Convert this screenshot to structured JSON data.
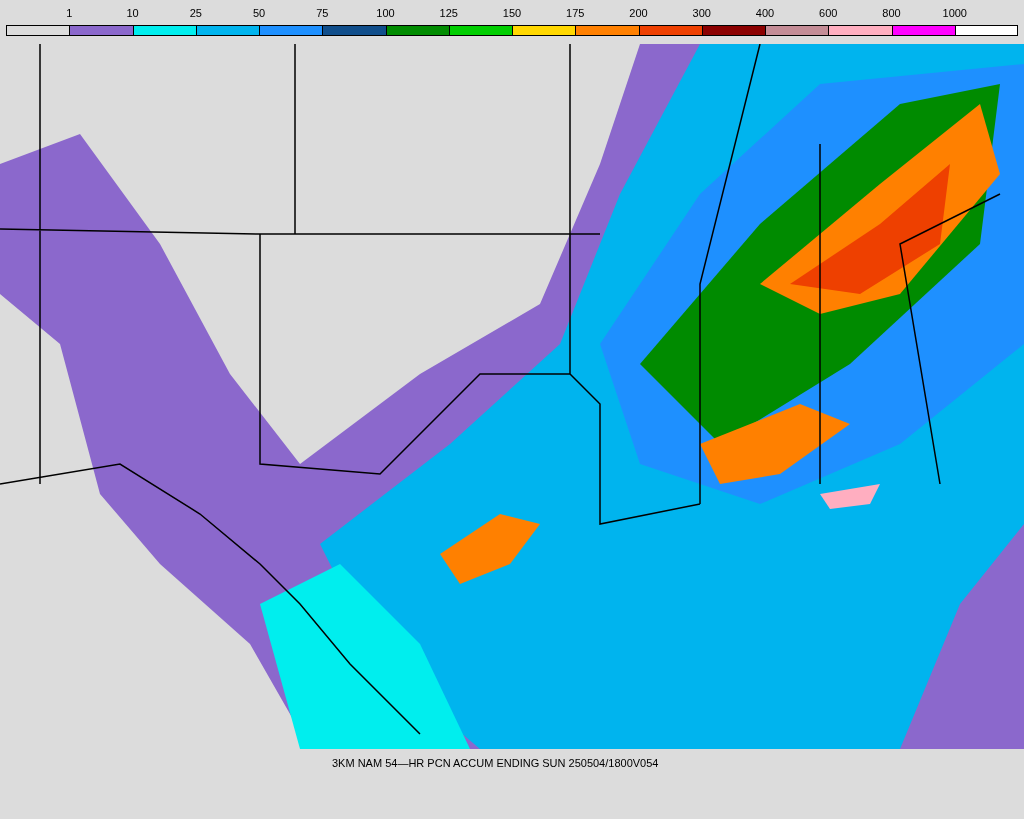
{
  "legend": {
    "labels": [
      "1",
      "10",
      "25",
      "50",
      "75",
      "100",
      "125",
      "150",
      "175",
      "200",
      "300",
      "400",
      "600",
      "800",
      "1000"
    ],
    "swatches": [
      {
        "color": "#dcdcdc"
      },
      {
        "color": "#8b68cc"
      },
      {
        "color": "#00eeee"
      },
      {
        "color": "#00b4ee"
      },
      {
        "color": "#1e90ff"
      },
      {
        "color": "#104e8b"
      },
      {
        "color": "#008b00"
      },
      {
        "color": "#00cd00"
      },
      {
        "color": "#ffd700"
      },
      {
        "color": "#ff8000"
      },
      {
        "color": "#ee4000"
      },
      {
        "color": "#8b0000"
      },
      {
        "color": "#c48c96"
      },
      {
        "color": "#ffaec0"
      },
      {
        "color": "#ff00ff"
      },
      {
        "color": "#ffffff"
      }
    ]
  },
  "caption": "3KM NAM 54—HR PCN ACCUM ENDING SUN 250504/1800V054"
}
